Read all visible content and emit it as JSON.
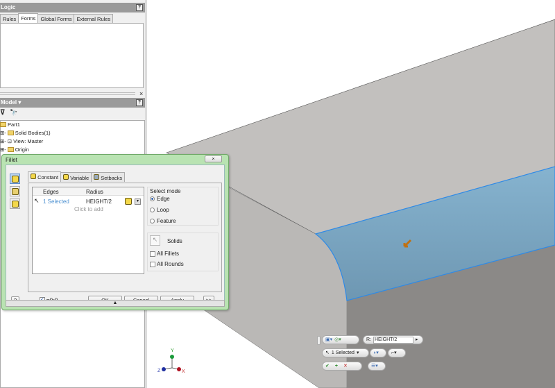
{
  "ilogic": {
    "title": "Logic",
    "tabs": [
      "Rules",
      "Forms",
      "Global Forms",
      "External Rules"
    ],
    "active_tab": "Forms",
    "help": "?",
    "close": "×"
  },
  "model": {
    "title": "Model ▾",
    "help": "?",
    "filter_icon": "funnel",
    "find_icon": "binoculars",
    "tree": [
      "Part1",
      "Solid Bodies(1)",
      "View: Master",
      "Origin"
    ]
  },
  "dialog": {
    "title": "Fillet",
    "close": "×",
    "tabs": [
      "Constant",
      "Variable",
      "Setbacks"
    ],
    "active_tab": "Constant",
    "table": {
      "headers": [
        "Edges",
        "Radius"
      ],
      "rows": [
        {
          "edges": "1 Selected",
          "radius": "HEIGHT/2"
        }
      ],
      "add_hint": "Click to add"
    },
    "select_mode": {
      "label": "Select mode",
      "options": [
        "Edge",
        "Loop",
        "Feature"
      ],
      "selected": "Edge"
    },
    "solids_label": "Solids",
    "all_fillets": "All Fillets",
    "all_rounds": "All Rounds",
    "preview_checked": true,
    "buttons": {
      "ok": "OK",
      "cancel": "Cancel",
      "apply": "Apply",
      "more": ">>",
      "help": "?"
    },
    "expand": "▲"
  },
  "minitoolbar": {
    "radius_label": "R:",
    "radius_value": "HEIGHT/2",
    "selected": "1 Selected",
    "ok": "✔",
    "add": "+",
    "cancel": "✕"
  },
  "triad": {
    "x": "X",
    "y": "Y",
    "z": "Z"
  },
  "colors": {
    "fillet": "#7eaac6",
    "edge": "#2f8ae6",
    "accent_green": "#b9e3b2"
  }
}
